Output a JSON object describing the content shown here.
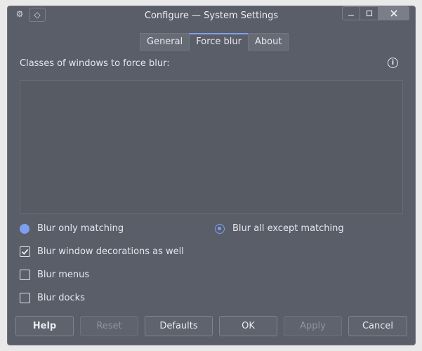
{
  "window": {
    "title": "Configure — System Settings",
    "icons": {
      "app": "gear-icon",
      "pin": "pin-icon",
      "minimize": "minimize-icon",
      "maximize": "maximize-icon",
      "close": "close-icon"
    }
  },
  "tabs": [
    {
      "label": "General",
      "active": false
    },
    {
      "label": "Force blur",
      "active": true
    },
    {
      "label": "About",
      "active": false
    }
  ],
  "classes_label": "Classes of windows to force blur:",
  "info_glyph": "i",
  "window_classes": [],
  "radios": {
    "blur_only_matching": "Blur only matching",
    "blur_all_except": "Blur all except matching",
    "selected": "blur_all_except"
  },
  "checkboxes": {
    "decorations": {
      "label": "Blur window decorations as well",
      "checked": true
    },
    "menus": {
      "label": "Blur menus",
      "checked": false
    },
    "docks": {
      "label": "Blur docks",
      "checked": false
    }
  },
  "buttons": {
    "help": "Help",
    "reset": "Reset",
    "defaults": "Defaults",
    "ok": "OK",
    "apply": "Apply",
    "cancel": "Cancel"
  },
  "colors": {
    "accent": "#7f9ef0",
    "background": "#5a5e68"
  }
}
